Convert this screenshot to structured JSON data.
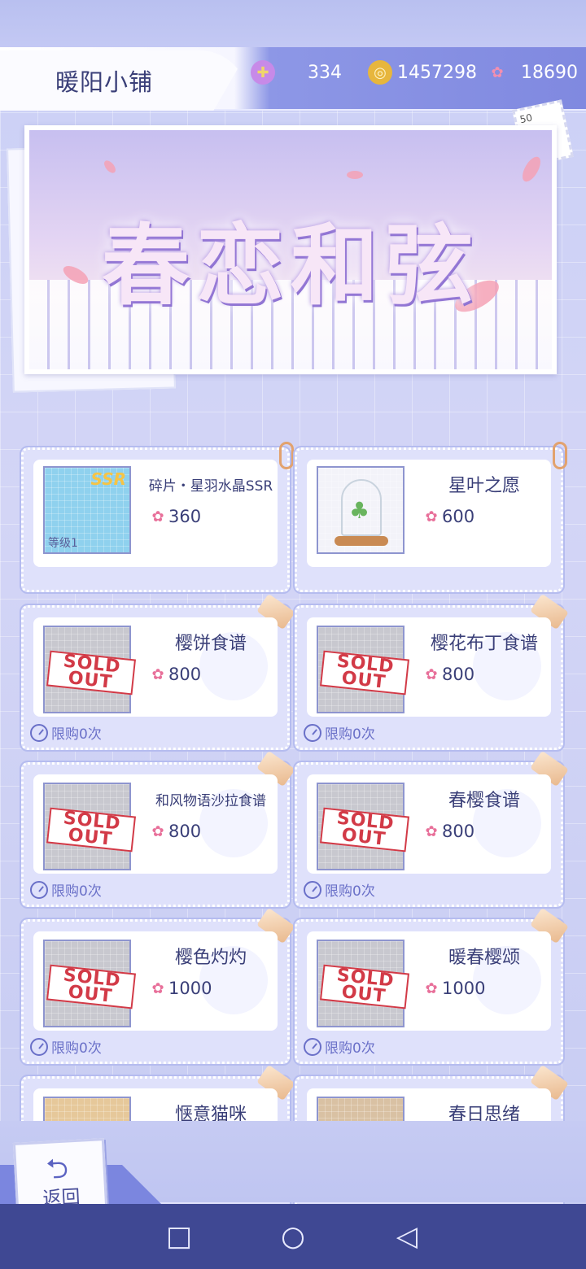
{
  "header": {
    "title": "暖阳小铺",
    "currencies": [
      {
        "icon": "swan-plus-icon",
        "value": "334"
      },
      {
        "icon": "gold-coin-icon",
        "value": "1457298"
      },
      {
        "icon": "sakura-petal-icon",
        "value": "18690"
      }
    ]
  },
  "banner": {
    "title": "春恋和弦",
    "stamp": "50"
  },
  "items": [
    {
      "name": "碎片・星羽水晶SSR",
      "price": "360",
      "level_label": "等级1",
      "badge": "SSR",
      "sold_out": false,
      "limit": ""
    },
    {
      "name": "星叶之愿",
      "price": "600",
      "sold_out": false,
      "limit": ""
    },
    {
      "name": "樱饼食谱",
      "price": "800",
      "sold_out": true,
      "limit": "限购0次"
    },
    {
      "name": "樱花布丁食谱",
      "price": "800",
      "sold_out": true,
      "limit": "限购0次"
    },
    {
      "name": "和风物语沙拉食谱",
      "price": "800",
      "sold_out": true,
      "limit": "限购0次"
    },
    {
      "name": "春樱食谱",
      "price": "800",
      "sold_out": true,
      "limit": "限购0次"
    },
    {
      "name": "樱色灼灼",
      "price": "1000",
      "sold_out": true,
      "limit": "限购0次"
    },
    {
      "name": "暖春樱颂",
      "price": "1000",
      "sold_out": true,
      "limit": "限购0次"
    },
    {
      "name": "惬意猫咪",
      "price": "",
      "sold_out": false,
      "limit": ""
    },
    {
      "name": "春日思绪",
      "price": "",
      "sold_out": false,
      "limit": ""
    }
  ],
  "soldout_text": {
    "line1": "SOLD",
    "line2": "OUT"
  },
  "back_button": {
    "label": "返回",
    "icon": "return-arrow-icon"
  },
  "system_nav": {
    "recent": "□",
    "home": "○",
    "back": "◁"
  },
  "colors": {
    "accent": "#7b86df",
    "text": "#3a3f78",
    "soldout": "#d23a47",
    "navbar": "#3f4893"
  }
}
